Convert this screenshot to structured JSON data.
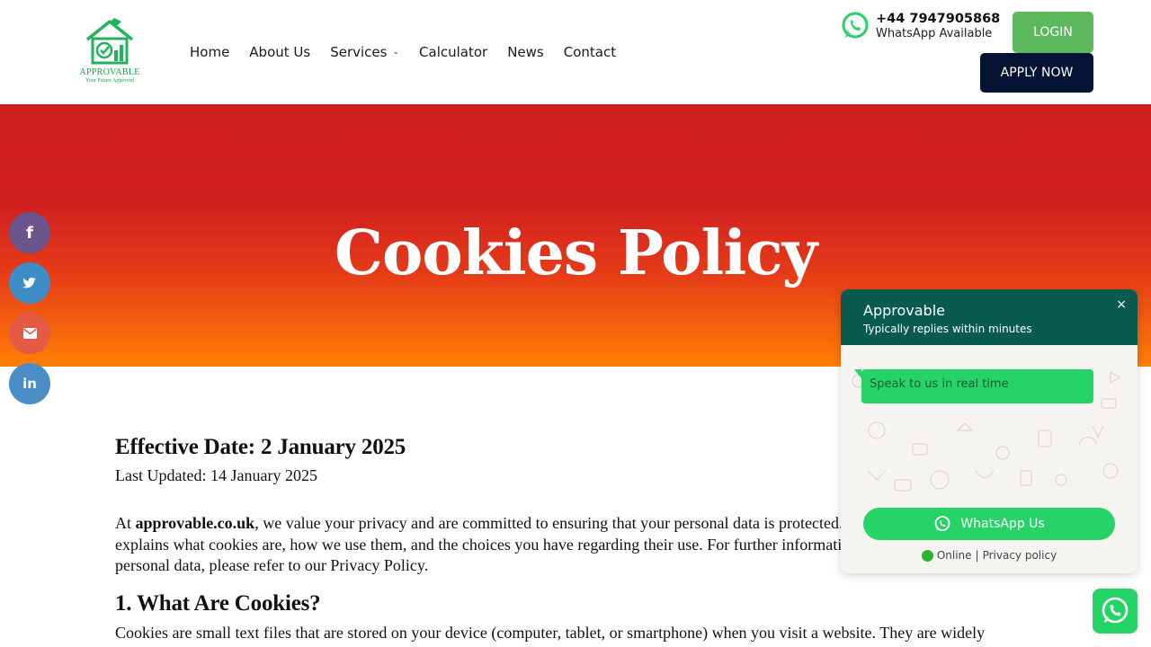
{
  "header": {
    "logo_name": "APPROVABLE",
    "logo_tagline": "Your Future Approved",
    "nav": [
      {
        "label": "Home"
      },
      {
        "label": "About Us"
      },
      {
        "label": "Services"
      },
      {
        "label": "Calculator"
      },
      {
        "label": "News"
      },
      {
        "label": "Contact"
      }
    ],
    "whatsapp_phone": "+44 7947905868",
    "whatsapp_status": "WhatsApp Available",
    "login_label": "LOGIN",
    "apply_label": "APPLY NOW"
  },
  "hero": {
    "title": "Cookies Policy",
    "gradient": [
      "#d01f1f",
      "#ff7f05"
    ]
  },
  "social": [
    {
      "name": "facebook",
      "icon": "facebook-icon",
      "color": "#6a568c"
    },
    {
      "name": "twitter",
      "icon": "twitter-icon",
      "color": "#3d8ec6"
    },
    {
      "name": "email",
      "icon": "email-icon",
      "color": "#e45a43"
    },
    {
      "name": "linkedin",
      "icon": "linkedin-icon",
      "color": "#4a8dc7"
    }
  ],
  "content": {
    "effective_date": "Effective Date: 2 January 2025",
    "last_updated": "Last Updated: 14 January 2025",
    "intro_prefix": "At ",
    "intro_site": "approvable.co.uk",
    "intro_rest": ", we value your privacy and are committed to ensuring that your personal data is protected. This Cookies Policy explains what cookies are, how we use them, and the choices you have regarding their use. For further information on how we handle your personal data, please refer to our Privacy Policy.",
    "section1_heading": "1. What Are Cookies?",
    "section1_text": "Cookies are small text files that are stored on your device (computer, tablet, or smartphone) when you visit a website. They are widely"
  },
  "whatsapp_widget": {
    "name": "Approvable",
    "reply_time": "Typically replies within minutes",
    "close_label": "×",
    "bubble_text": "Speak to us in real time",
    "button_label": "WhatsApp Us",
    "status": "Online",
    "separator": "|",
    "privacy_link": "Privacy policy",
    "colors": {
      "header": "#0a5b4f",
      "accent": "#25d366"
    }
  }
}
